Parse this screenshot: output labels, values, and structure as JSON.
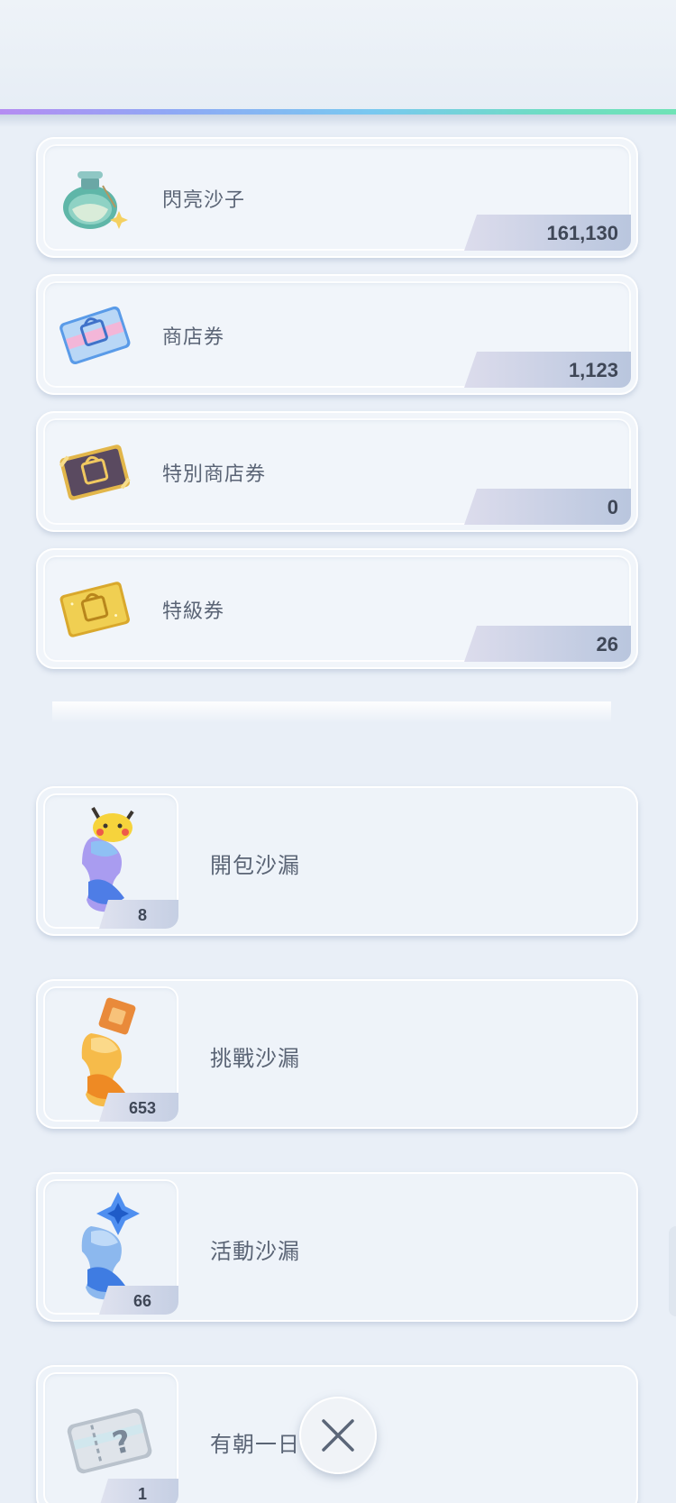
{
  "currencies": [
    {
      "label": "閃亮沙子",
      "amount": "161,130",
      "icon": "shiny-sand-bottle-icon"
    },
    {
      "label": "商店券",
      "amount": "1,123",
      "icon": "shop-ticket-icon"
    },
    {
      "label": "特別商店券",
      "amount": "0",
      "icon": "special-shop-ticket-icon"
    },
    {
      "label": "特級券",
      "amount": "26",
      "icon": "premium-ticket-icon"
    }
  ],
  "hourglasses": [
    {
      "label": "開包沙漏",
      "count": "8",
      "icon": "pack-hourglass-icon"
    },
    {
      "label": "挑戰沙漏",
      "count": "653",
      "icon": "challenge-hourglass-icon"
    },
    {
      "label": "活動沙漏",
      "count": "66",
      "icon": "event-hourglass-icon"
    },
    {
      "label": "有朝一日",
      "count": "1",
      "icon": "someday-ticket-icon"
    }
  ],
  "colors": {
    "accent_rainbow_start": "#b58cf2",
    "accent_rainbow_end": "#6fe3b6",
    "background": "#e9eff7"
  }
}
